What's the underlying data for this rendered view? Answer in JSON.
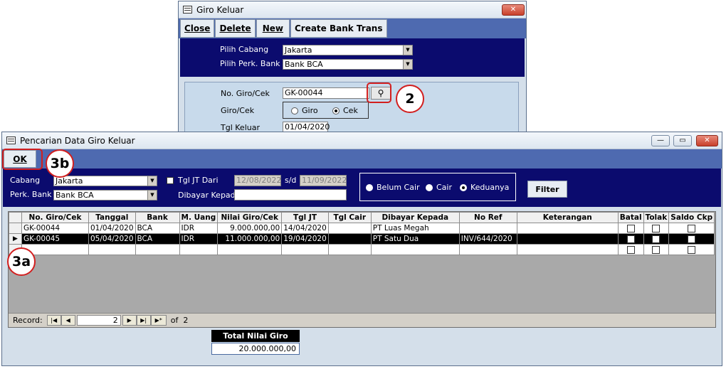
{
  "giro_window": {
    "title": "Giro Keluar",
    "buttons": {
      "close": "Close",
      "delete": "Delete",
      "new": "New",
      "create": "Create Bank Trans"
    },
    "pilih_cabang_label": "Pilih Cabang",
    "pilih_cabang_value": "Jakarta",
    "pilih_bank_label": "Pilih Perk. Bank",
    "pilih_bank_value": "Bank BCA",
    "no_giro_label": "No. Giro/Cek",
    "no_giro_value": "GK-00044",
    "giro_cek_label": "Giro/Cek",
    "radio_giro": "Giro",
    "radio_cek": "Cek",
    "selected_type": "Cek",
    "tgl_keluar_label": "Tgl Keluar",
    "tgl_keluar_value": "01/04/2020"
  },
  "search_window": {
    "title": "Pencarian Data Giro Keluar",
    "ok_label": "OK",
    "cabang_label": "Cabang",
    "cabang_value": "Jakarta",
    "perk_bank_label": "Perk. Bank",
    "perk_bank_value": "Bank BCA",
    "tgl_jt_label": "Tgl JT Dari",
    "tgl_from": "12/08/2022",
    "sd_label": "s/d",
    "tgl_to": "11/09/2022",
    "dibayar_label": "Dibayar Kepada",
    "dibayar_value": "",
    "status_options": [
      "Belum Cair",
      "Cair",
      "Keduanya"
    ],
    "status_selected": "Keduanya",
    "filter_label": "Filter",
    "columns": [
      "No. Giro/Cek",
      "Tanggal",
      "Bank",
      "M. Uang",
      "Nilai Giro/Cek",
      "Tgl JT",
      "Tgl Cair",
      "Dibayar Kepada",
      "No Ref",
      "Keterangan",
      "Batal",
      "Tolak",
      "Saldo Ckp"
    ],
    "rows": [
      {
        "no": "GK-00044",
        "tanggal": "01/04/2020",
        "bank": "BCA",
        "uang": "IDR",
        "nilai": "9.000.000,00",
        "tgl_jt": "14/04/2020",
        "tgl_cair": "",
        "dibayar": "PT Luas Megah",
        "ref": "",
        "ket": ""
      },
      {
        "no": "GK-00045",
        "tanggal": "05/04/2020",
        "bank": "BCA",
        "uang": "IDR",
        "nilai": "11.000.000,00",
        "tgl_jt": "19/04/2020",
        "tgl_cair": "",
        "dibayar": "PT Satu Dua",
        "ref": "INV/644/2020",
        "ket": ""
      }
    ],
    "record_label": "Record:",
    "record_current": "2",
    "record_of": "of  2",
    "total_label": "Total Nilai Giro",
    "total_value": "20.000.000,00"
  },
  "callouts": {
    "c2": "2",
    "c3a": "3a",
    "c3b": "3b"
  }
}
